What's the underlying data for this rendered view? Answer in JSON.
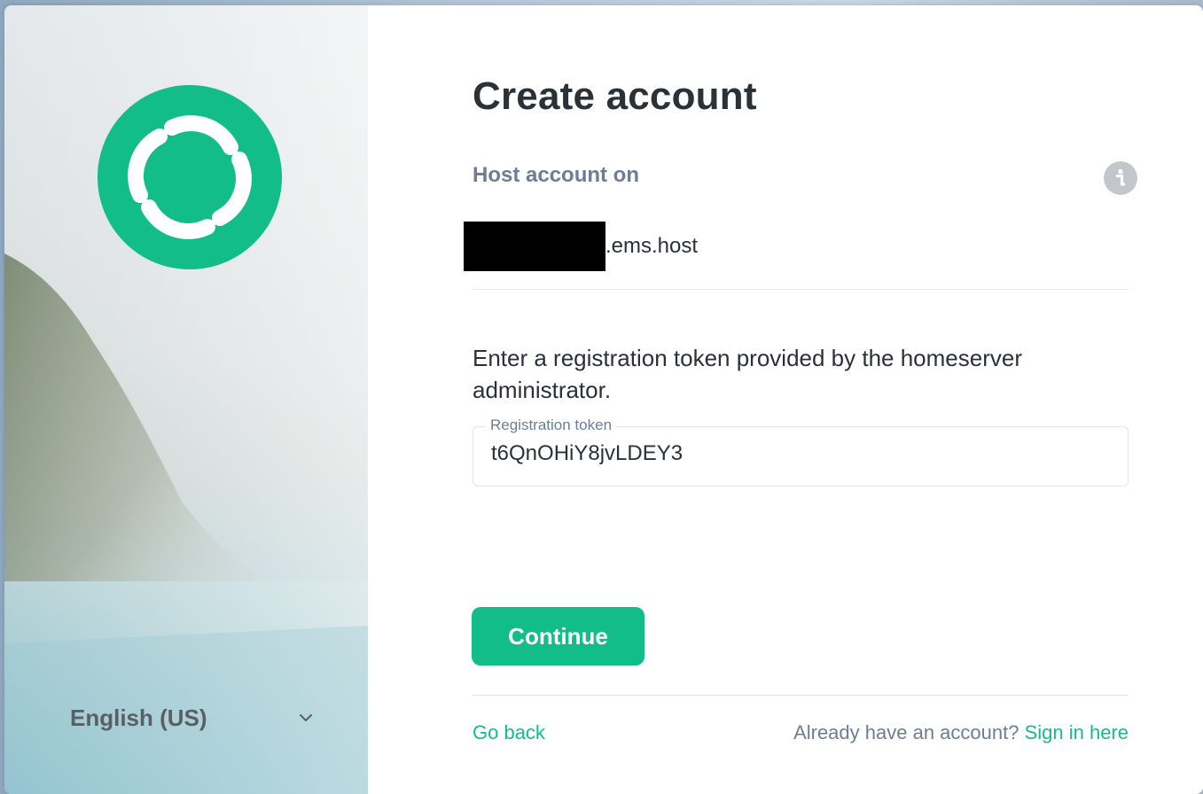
{
  "sidebar": {
    "language": "English (US)",
    "language_icon": "chevron-down-icon",
    "logo_icon": "element-logo-icon"
  },
  "main": {
    "title": "Create account",
    "host_label": "Host account on",
    "info_icon": "info-icon",
    "host_suffix": ".ems.host",
    "instructions": "Enter a registration token provided by the homeserver administrator.",
    "token_field": {
      "label": "Registration token",
      "value": "t6QnOHiY8jvLDEY3"
    },
    "continue_label": "Continue",
    "go_back_label": "Go back",
    "already_have_account": "Already have an account?",
    "sign_in_label": "Sign in here"
  },
  "colors": {
    "accent": "#13bd8a",
    "text_primary": "#2a3137",
    "text_secondary": "#6e7d94",
    "divider": "#e3e6ea"
  }
}
